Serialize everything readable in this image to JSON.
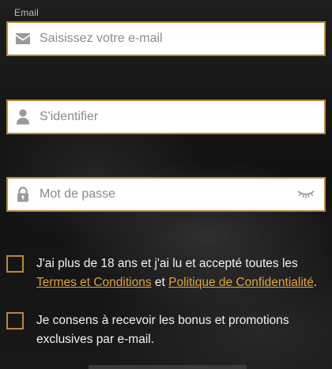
{
  "email": {
    "label": "Email",
    "placeholder": "Saisissez votre e-mail",
    "icon": "envelope-icon"
  },
  "username": {
    "placeholder": "S'identifier",
    "icon": "user-icon"
  },
  "password": {
    "placeholder": "Mot de passe",
    "icon": "lock-icon",
    "toggle_icon": "eye-closed-icon"
  },
  "age_consent": {
    "text_before": "J'ai plus de 18 ans et j'ai lu et accepté toutes les",
    "terms_link": "Termes et Conditions",
    "connector": "et",
    "privacy_link": "Politique de Confidentialité",
    "text_after": "."
  },
  "bonus_consent": {
    "text": "Je consens à recevoir les bonus et promotions exclusives par e-mail."
  },
  "colors": {
    "accent": "#b8893a",
    "link": "#e0a53a",
    "icon": "#9a9a9a"
  }
}
